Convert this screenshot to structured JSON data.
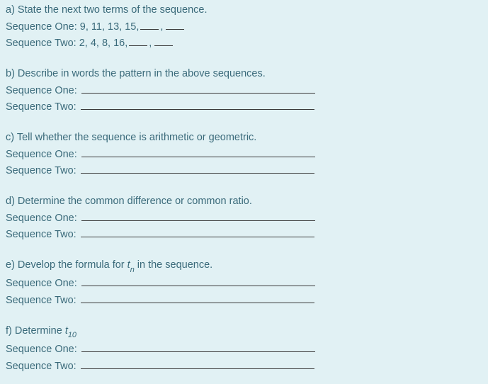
{
  "a": {
    "prompt": "a) State the next two terms of the sequence.",
    "seq1_label": "Sequence One: 9, 11, 13, 15,",
    "seq2_label": "Sequence Two: 2, 4, 8, 16,"
  },
  "b": {
    "prompt": "b) Describe in words the pattern in the above sequences.",
    "seq1_label": "Sequence One:",
    "seq2_label": "Sequence Two:"
  },
  "c": {
    "prompt": "c) Tell whether the sequence is arithmetic or geometric.",
    "seq1_label": "Sequence One:",
    "seq2_label": "Sequence Two:"
  },
  "d": {
    "prompt": "d) Determine the common difference or common ratio.",
    "seq1_label": "Sequence One:",
    "seq2_label": "Sequence Two:"
  },
  "e": {
    "prompt_pre": "e) Develop the formula for ",
    "prompt_var": "t",
    "prompt_sub": "n",
    "prompt_post": " in the sequence.",
    "seq1_label": "Sequence One:",
    "seq2_label": "Sequence Two:"
  },
  "f": {
    "prompt_pre": "f) Determine ",
    "prompt_var": "t",
    "prompt_sub": "10",
    "seq1_label": "Sequence One:",
    "seq2_label": "Sequence Two:"
  }
}
